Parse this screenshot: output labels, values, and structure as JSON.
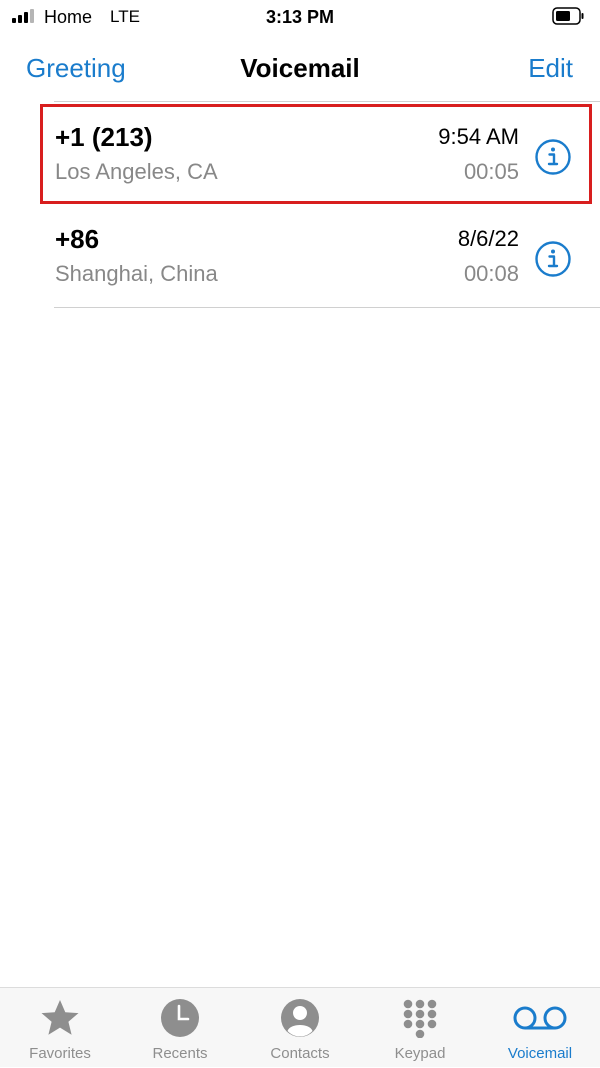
{
  "status_bar": {
    "carrier": "Home",
    "network": "LTE",
    "time": "3:13 PM"
  },
  "nav": {
    "left_button": "Greeting",
    "title": "Voicemail",
    "right_button": "Edit"
  },
  "voicemails": [
    {
      "caller": "+1 (213)",
      "location": "Los Angeles, CA",
      "date": "9:54 AM",
      "duration": "00:05"
    },
    {
      "caller": "+86",
      "location": "Shanghai, China",
      "date": "8/6/22",
      "duration": "00:08"
    }
  ],
  "tabs": [
    {
      "label": "Favorites",
      "icon": "star-icon",
      "active": false
    },
    {
      "label": "Recents",
      "icon": "clock-icon",
      "active": false
    },
    {
      "label": "Contacts",
      "icon": "person-icon",
      "active": false
    },
    {
      "label": "Keypad",
      "icon": "keypad-icon",
      "active": false
    },
    {
      "label": "Voicemail",
      "icon": "voicemail-icon",
      "active": true
    }
  ],
  "colors": {
    "accent": "#1a7ccc",
    "highlight": "#d81e1e",
    "secondary_text": "#888888",
    "inactive_tab": "#8e8e8e"
  }
}
